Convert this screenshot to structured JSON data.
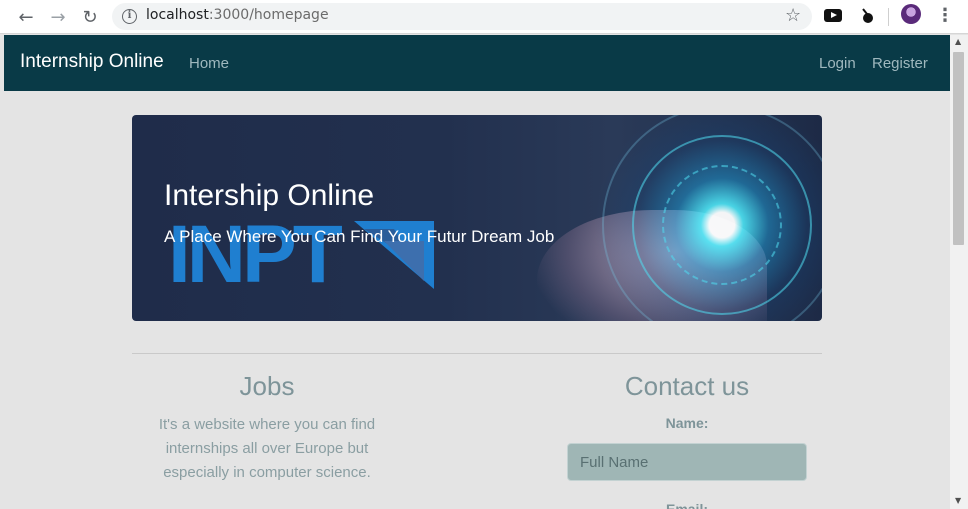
{
  "browser": {
    "url_host": "localhost",
    "url_path": ":3000/homepage",
    "back_icon": "←",
    "forward_icon": "→",
    "reload_icon": "↻",
    "info_icon": "i",
    "star_icon": "☆",
    "menu_icon": "⋮"
  },
  "navbar": {
    "brand": "Internship Online",
    "home": "Home",
    "login": "Login",
    "register": "Register",
    "background": "#093a47"
  },
  "hero": {
    "title": "Intership Online",
    "subtitle": "A Place Where You Can Find Your Futur Dream Job",
    "logo_text": "INPT"
  },
  "jobs": {
    "title": "Jobs",
    "text": "It's a website where you can find internships all over Europe but especially in computer science."
  },
  "contact": {
    "title": "Contact us",
    "name_label": "Name:",
    "name_placeholder": "Full Name",
    "email_label": "Email:"
  }
}
